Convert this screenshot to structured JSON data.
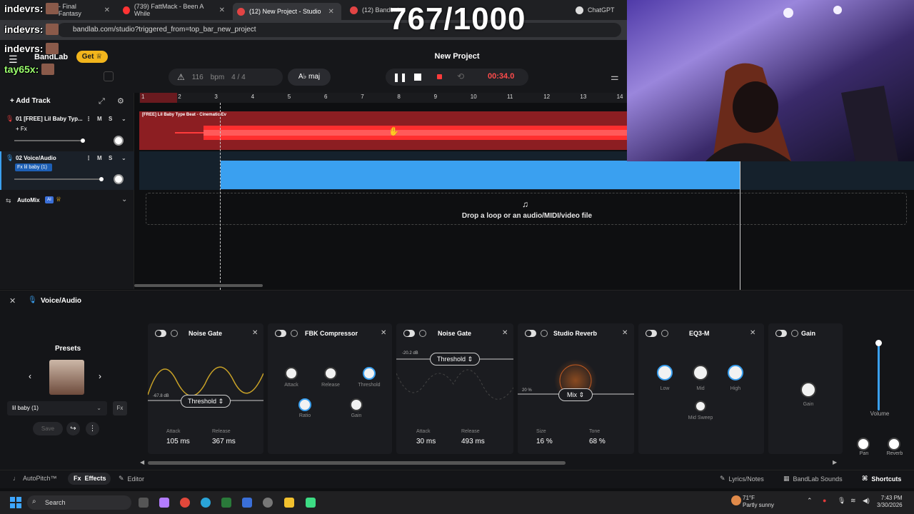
{
  "stream": {
    "counter": "767/1000",
    "chat": [
      {
        "user": "indevrs:",
        "color": "#ffffff"
      },
      {
        "user": "indevrs:",
        "color": "#ffffff"
      },
      {
        "user": "indevrs:",
        "color": "#ffffff"
      },
      {
        "user": "tay65x:",
        "color": "#9bff6e"
      }
    ]
  },
  "browser": {
    "tabs": [
      {
        "label": "- Final Fantasy",
        "favicon_color": "#cc3d3d"
      },
      {
        "label": "(739) FattMack - Been A While",
        "favicon_color": "#ff3333"
      },
      {
        "label": "(12) New Project - Studio",
        "favicon_color": "#e24444",
        "active": true
      },
      {
        "label": "(12) BandLab",
        "favicon_color": "#e24444"
      },
      {
        "label": "ChatGPT",
        "favicon_color": "#dddddd"
      }
    ],
    "url": "bandlab.com/studio?triggered_from=top_bar_new_project"
  },
  "app": {
    "brand": "BandLab",
    "get_label": "Get",
    "project_title": "New Project",
    "bpm_value": "116",
    "bpm_unit": "bpm",
    "time_signature": "4 / 4",
    "key_label": "A♭ maj",
    "time": "00:34.0",
    "accent": "#3aa0f0",
    "record_color": "#ff4b4b"
  },
  "tracks": {
    "add_label": "Add Track",
    "items": [
      {
        "name": "01 [FREE] Lil Baby Typ...",
        "fx": "+ Fx",
        "color": "#e23a3a",
        "region_label": "[FREE] Lil Baby Type Beat - Cinematic Ev"
      },
      {
        "name": "02 Voice/Audio",
        "fx": "Fx lil baby (1)",
        "color": "#3aa0f0"
      }
    ],
    "mute": "M",
    "solo": "S",
    "automix": "AutoMix",
    "ai_badge": "AI"
  },
  "ruler": [
    "1",
    "2",
    "3",
    "4",
    "5",
    "6",
    "7",
    "8",
    "9",
    "10",
    "11",
    "12",
    "13",
    "14"
  ],
  "dropzone_text": "Drop a loop or an audio/MIDI/video file",
  "fx_panel": {
    "track_title": "Voice/Audio",
    "presets_label": "Presets",
    "preset_value": "lil baby (1)",
    "save_label": "Save",
    "cards": [
      {
        "title": "Noise Gate",
        "db": "-67.8 dB",
        "dropdown": "Threshold",
        "left_label": "Attack",
        "left_value": "105 ms",
        "right_label": "Release",
        "right_value": "367 ms"
      },
      {
        "title": "FBK Compressor",
        "knobs": [
          "Attack",
          "Release",
          "Threshold",
          "Ratio",
          "Gain"
        ]
      },
      {
        "title": "Noise Gate",
        "db": "-20.2 dB",
        "dropdown": "Threshold",
        "left_label": "Attack",
        "left_value": "30 ms",
        "right_label": "Release",
        "right_value": "493 ms"
      },
      {
        "title": "Studio Reverb",
        "db": "20 %",
        "dropdown": "Mix",
        "left_label": "Size",
        "left_value": "16 %",
        "right_label": "Tone",
        "right_value": "68 %"
      },
      {
        "title": "EQ3-M",
        "knobs": [
          "Low",
          "Mid",
          "High",
          "Mid Sweep"
        ]
      },
      {
        "title": "Gain",
        "knobs": [
          "Gain"
        ]
      }
    ],
    "volume_label": "Volume",
    "pan_label": "Pan",
    "reverb_label": "Reverb"
  },
  "footer": {
    "autopitch": "AutoPitch™",
    "effects": "Effects",
    "editor": "Editor",
    "lyrics": "Lyrics/Notes",
    "sounds": "BandLab Sounds",
    "shortcuts": "Shortcuts"
  },
  "taskbar": {
    "search_placeholder": "Search",
    "weather_temp": "71°F",
    "weather_desc": "Partly sunny",
    "time": "7:43 PM",
    "date": "3/30/2026"
  }
}
